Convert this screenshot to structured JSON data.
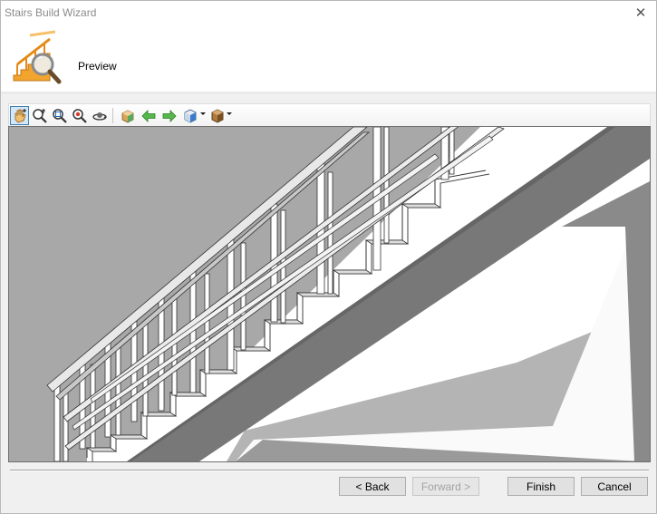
{
  "window": {
    "title": "Stairs Build Wizard",
    "close_label": "✕"
  },
  "header": {
    "heading": "Preview",
    "logo_icon": "stairs-magnifier-icon"
  },
  "toolbar": {
    "tools": [
      {
        "name": "pan-icon",
        "active": true
      },
      {
        "name": "zoom-in-out-icon"
      },
      {
        "name": "zoom-window-icon"
      },
      {
        "name": "zoom-extents-icon"
      },
      {
        "name": "orbit-icon"
      },
      {
        "name": "view-box-icon"
      },
      {
        "name": "arrow-left-icon"
      },
      {
        "name": "arrow-right-icon"
      },
      {
        "name": "view-cube-icon",
        "dropdown": true
      },
      {
        "name": "render-style-icon",
        "dropdown": true
      }
    ]
  },
  "footer": {
    "back_label": "< Back",
    "forward_label": "Forward >",
    "finish_label": "Finish",
    "cancel_label": "Cancel"
  }
}
